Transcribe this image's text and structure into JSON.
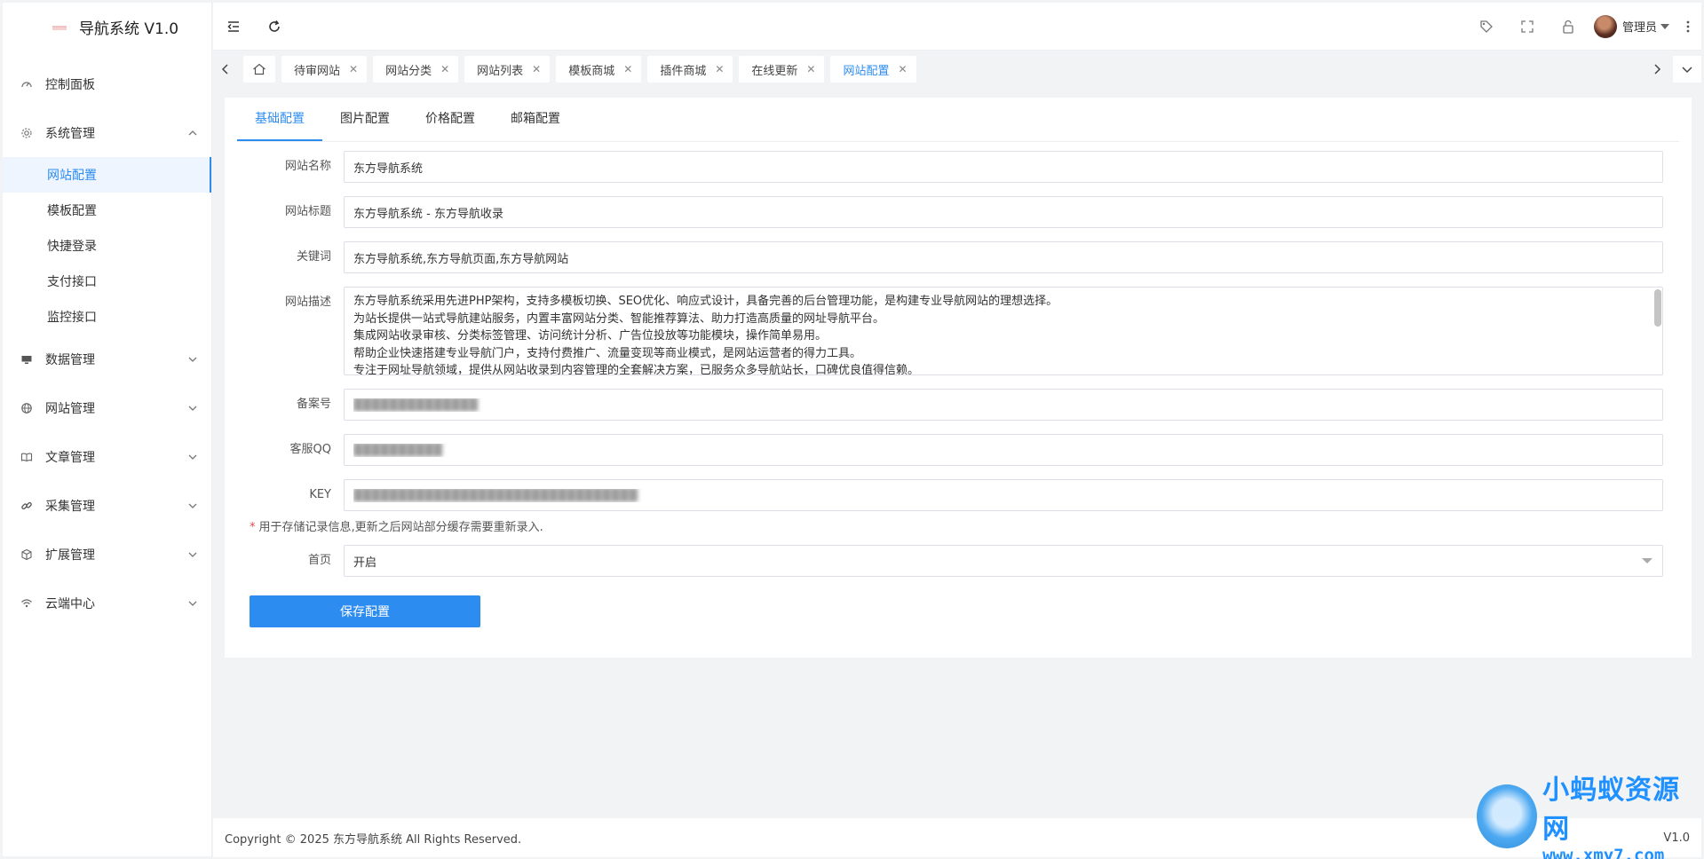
{
  "app": {
    "title": "导航系统 V1.0"
  },
  "sidebar": {
    "items": [
      {
        "label": "控制面板",
        "icon": "dashboard-icon"
      },
      {
        "label": "系统管理",
        "icon": "gear-icon",
        "expanded": true,
        "children": [
          "网站配置",
          "模板配置",
          "快捷登录",
          "支付接口",
          "监控接口"
        ]
      },
      {
        "label": "数据管理",
        "icon": "monitor-icon"
      },
      {
        "label": "网站管理",
        "icon": "globe-icon"
      },
      {
        "label": "文章管理",
        "icon": "book-icon"
      },
      {
        "label": "采集管理",
        "icon": "link-icon"
      },
      {
        "label": "扩展管理",
        "icon": "cube-icon"
      },
      {
        "label": "云端中心",
        "icon": "wifi-icon"
      }
    ],
    "active_child": "网站配置"
  },
  "header": {
    "user": "管理员"
  },
  "tabs": [
    "待审网站",
    "网站分类",
    "网站列表",
    "模板商城",
    "插件商城",
    "在线更新",
    "网站配置"
  ],
  "active_tab": "网站配置",
  "config_tabs": [
    "基础配置",
    "图片配置",
    "价格配置",
    "邮箱配置"
  ],
  "active_config_tab": "基础配置",
  "form": {
    "site_name": {
      "label": "网站名称",
      "value": "东方导航系统"
    },
    "site_title": {
      "label": "网站标题",
      "value": "东方导航系统 - 东方导航收录"
    },
    "keywords": {
      "label": "关键词",
      "value": "东方导航系统,东方导航页面,东方导航网站"
    },
    "description": {
      "label": "网站描述",
      "lines": [
        "东方导航系统采用先进PHP架构，支持多模板切换、SEO优化、响应式设计，具备完善的后台管理功能，是构建专业导航网站的理想选择。",
        "为站长提供一站式导航建站服务，内置丰富网站分类、智能推荐算法、助力打造高质量的网址导航平台。",
        "集成网站收录审核、分类标签管理、访问统计分析、广告位投放等功能模块，操作简单易用。",
        "帮助企业快速搭建专业导航门户，支持付费推广、流量变现等商业模式，是网站运营者的得力工具。",
        "专注于网址导航领域，提供从网站收录到内容管理的全套解决方案，已服务众多导航站长，口碑优良值得信赖。"
      ]
    },
    "icp": {
      "label": "备案号",
      "value": "██████████████"
    },
    "qq": {
      "label": "客服QQ",
      "value": "██████████"
    },
    "key": {
      "label": "KEY",
      "value": "████████████████████████████████"
    },
    "note": "用于存储记录信息,更新之后网站部分缓存需要重新录入.",
    "homepage": {
      "label": "首页",
      "value": "开启"
    },
    "save": "保存配置"
  },
  "footer": {
    "copyright_prefix": "Copyright © 2025 ",
    "brand": "东方导航系统",
    "copyright_suffix": " All Rights Reserved.",
    "version": "V1.0"
  },
  "watermark": {
    "line1": "小蚂蚁资源网",
    "line2": "www.xmy7.com"
  },
  "colors": {
    "accent": "#2d8cf0",
    "required": "#e5484d"
  }
}
